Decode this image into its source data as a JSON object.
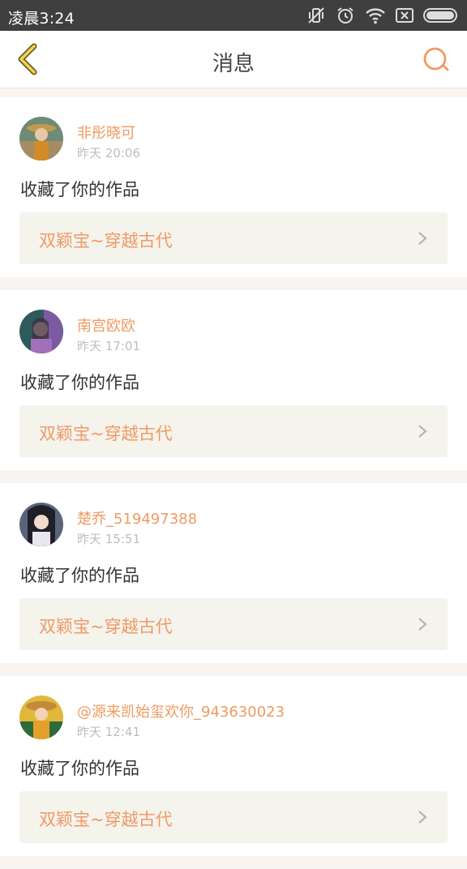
{
  "status_bar": {
    "time": "凌晨3:24"
  },
  "nav": {
    "title": "消息"
  },
  "notifications": [
    {
      "username": "非彤晓可",
      "time": "昨天 20:06",
      "action": "收藏了你的作品",
      "work_title": "双颖宝~穿越古代"
    },
    {
      "username": "南宫欧欧",
      "time": "昨天 17:01",
      "action": "收藏了你的作品",
      "work_title": "双颖宝~穿越古代"
    },
    {
      "username": "楚乔_519497388",
      "time": "昨天 15:51",
      "action": "收藏了你的作品",
      "work_title": "双颖宝~穿越古代"
    },
    {
      "username": "@源来凯始玺欢你_943630023",
      "time": "昨天 12:41",
      "action": "收藏了你的作品",
      "work_title": "双颖宝~穿越古代"
    }
  ],
  "colors": {
    "accent": "#f09a61",
    "status_bar": "#3f3f3f",
    "card_link_bg": "#f4f3ec"
  }
}
